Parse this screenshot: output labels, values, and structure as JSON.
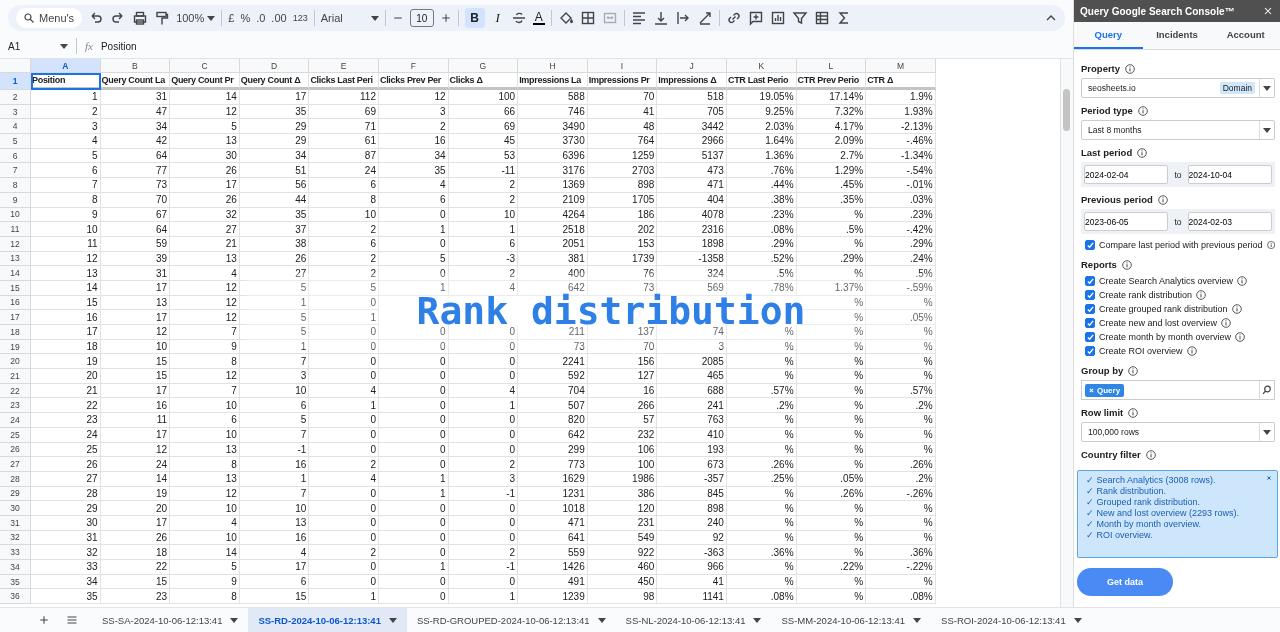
{
  "toolbar": {
    "search": "Menu's",
    "zoom": "100%",
    "currency": "£",
    "percent": "%",
    "decrease_decimals": ".0",
    "increase_decimals": ".00",
    "number_format": "123",
    "font": "Arial",
    "font_size": "10",
    "bold": {
      "label": "B",
      "selected": true
    },
    "italic": "I",
    "text_color": "A"
  },
  "formula_bar": {
    "cell_ref": "A1",
    "fx": "fx",
    "value": "Position"
  },
  "columns": [
    {
      "letter": "A",
      "selected": true
    },
    {
      "letter": "B",
      "selected": false
    },
    {
      "letter": "C",
      "selected": false
    },
    {
      "letter": "D",
      "selected": false
    },
    {
      "letter": "E",
      "selected": false
    },
    {
      "letter": "F",
      "selected": false
    },
    {
      "letter": "G",
      "selected": false
    },
    {
      "letter": "H",
      "selected": false
    },
    {
      "letter": "I",
      "selected": false
    },
    {
      "letter": "J",
      "selected": false
    },
    {
      "letter": "K",
      "selected": false
    },
    {
      "letter": "L",
      "selected": false
    },
    {
      "letter": "M",
      "selected": false
    }
  ],
  "header_row": {
    "num": "1",
    "selected": true,
    "cells": [
      "Position",
      "Query Count La",
      "Query Count Pr",
      "Query Count Δ",
      "Clicks Last Peri",
      "Clicks Prev Per",
      "Clicks Δ",
      "Impressions La",
      "Impressions Pr",
      "Impressions Δ",
      "CTR Last Perio",
      "CTR Prev Perio",
      "CTR Δ"
    ]
  },
  "rows": [
    {
      "num": "2",
      "cells": [
        "1",
        "31",
        "14",
        "17",
        "112",
        "12",
        "100",
        "588",
        "70",
        "518",
        "19.05%",
        "17.14%",
        "1.9%"
      ]
    },
    {
      "num": "3",
      "cells": [
        "2",
        "47",
        "12",
        "35",
        "69",
        "3",
        "66",
        "746",
        "41",
        "705",
        "9.25%",
        "7.32%",
        "1.93%"
      ]
    },
    {
      "num": "4",
      "cells": [
        "3",
        "34",
        "5",
        "29",
        "71",
        "2",
        "69",
        "3490",
        "48",
        "3442",
        "2.03%",
        "4.17%",
        "-2.13%"
      ]
    },
    {
      "num": "5",
      "cells": [
        "4",
        "42",
        "13",
        "29",
        "61",
        "16",
        "45",
        "3730",
        "764",
        "2966",
        "1.64%",
        "2.09%",
        "-.46%"
      ]
    },
    {
      "num": "6",
      "cells": [
        "5",
        "64",
        "30",
        "34",
        "87",
        "34",
        "53",
        "6396",
        "1259",
        "5137",
        "1.36%",
        "2.7%",
        "-1.34%"
      ]
    },
    {
      "num": "7",
      "cells": [
        "6",
        "77",
        "26",
        "51",
        "24",
        "35",
        "-11",
        "3176",
        "2703",
        "473",
        ".76%",
        "1.29%",
        "-.54%"
      ]
    },
    {
      "num": "8",
      "cells": [
        "7",
        "73",
        "17",
        "56",
        "6",
        "4",
        "2",
        "1369",
        "898",
        "471",
        ".44%",
        ".45%",
        "-.01%"
      ]
    },
    {
      "num": "9",
      "cells": [
        "8",
        "70",
        "26",
        "44",
        "8",
        "6",
        "2",
        "2109",
        "1705",
        "404",
        ".38%",
        ".35%",
        ".03%"
      ]
    },
    {
      "num": "10",
      "cells": [
        "9",
        "67",
        "32",
        "35",
        "10",
        "0",
        "10",
        "4264",
        "186",
        "4078",
        ".23%",
        "%",
        ".23%"
      ]
    },
    {
      "num": "11",
      "cells": [
        "10",
        "64",
        "27",
        "37",
        "2",
        "1",
        "1",
        "2518",
        "202",
        "2316",
        ".08%",
        ".5%",
        "-.42%"
      ]
    },
    {
      "num": "12",
      "cells": [
        "11",
        "59",
        "21",
        "38",
        "6",
        "0",
        "6",
        "2051",
        "153",
        "1898",
        ".29%",
        "%",
        ".29%"
      ]
    },
    {
      "num": "13",
      "cells": [
        "12",
        "39",
        "13",
        "26",
        "2",
        "5",
        "-3",
        "381",
        "1739",
        "-1358",
        ".52%",
        ".29%",
        ".24%"
      ]
    },
    {
      "num": "14",
      "cells": [
        "13",
        "31",
        "4",
        "27",
        "2",
        "0",
        "2",
        "400",
        "76",
        "324",
        ".5%",
        "%",
        ".5%"
      ]
    },
    {
      "num": "15",
      "cells": [
        "14",
        "17",
        "12",
        "5",
        "5",
        "1",
        "4",
        "642",
        "73",
        "569",
        ".78%",
        "1.37%",
        "-.59%"
      ]
    },
    {
      "num": "16",
      "cells": [
        "15",
        "13",
        "12",
        "1",
        "0",
        null,
        null,
        null,
        null,
        null,
        null,
        "%",
        "%"
      ]
    },
    {
      "num": "17",
      "cells": [
        "16",
        "17",
        "12",
        "5",
        "1",
        null,
        null,
        null,
        null,
        null,
        null,
        "%",
        ".05%"
      ]
    },
    {
      "num": "18",
      "cells": [
        "17",
        "12",
        "7",
        "5",
        "0",
        "0",
        "0",
        "211",
        "137",
        "74",
        "%",
        "%",
        "%"
      ]
    },
    {
      "num": "19",
      "cells": [
        "18",
        "10",
        "9",
        "1",
        "0",
        "0",
        "0",
        "73",
        "70",
        "3",
        "%",
        "%",
        "%"
      ]
    },
    {
      "num": "20",
      "cells": [
        "19",
        "15",
        "8",
        "7",
        "0",
        "0",
        "0",
        "2241",
        "156",
        "2085",
        "%",
        "%",
        "%"
      ]
    },
    {
      "num": "21",
      "cells": [
        "20",
        "15",
        "12",
        "3",
        "0",
        "0",
        "0",
        "592",
        "127",
        "465",
        "%",
        "%",
        "%"
      ]
    },
    {
      "num": "22",
      "cells": [
        "21",
        "17",
        "7",
        "10",
        "4",
        "0",
        "4",
        "704",
        "16",
        "688",
        ".57%",
        "%",
        ".57%"
      ]
    },
    {
      "num": "23",
      "cells": [
        "22",
        "16",
        "10",
        "6",
        "1",
        "0",
        "1",
        "507",
        "266",
        "241",
        ".2%",
        "%",
        ".2%"
      ]
    },
    {
      "num": "24",
      "cells": [
        "23",
        "11",
        "6",
        "5",
        "0",
        "0",
        "0",
        "820",
        "57",
        "763",
        "%",
        "%",
        "%"
      ]
    },
    {
      "num": "25",
      "cells": [
        "24",
        "17",
        "10",
        "7",
        "0",
        "0",
        "0",
        "642",
        "232",
        "410",
        "%",
        "%",
        "%"
      ]
    },
    {
      "num": "26",
      "cells": [
        "25",
        "12",
        "13",
        "-1",
        "0",
        "0",
        "0",
        "299",
        "106",
        "193",
        "%",
        "%",
        "%"
      ]
    },
    {
      "num": "27",
      "cells": [
        "26",
        "24",
        "8",
        "16",
        "2",
        "0",
        "2",
        "773",
        "100",
        "673",
        ".26%",
        "%",
        ".26%"
      ]
    },
    {
      "num": "28",
      "cells": [
        "27",
        "14",
        "13",
        "1",
        "4",
        "1",
        "3",
        "1629",
        "1986",
        "-357",
        ".25%",
        ".05%",
        ".2%"
      ]
    },
    {
      "num": "29",
      "cells": [
        "28",
        "19",
        "12",
        "7",
        "0",
        "1",
        "-1",
        "1231",
        "386",
        "845",
        "%",
        ".26%",
        "-.26%"
      ]
    },
    {
      "num": "30",
      "cells": [
        "29",
        "20",
        "10",
        "10",
        "0",
        "0",
        "0",
        "1018",
        "120",
        "898",
        "%",
        "%",
        "%"
      ]
    },
    {
      "num": "31",
      "cells": [
        "30",
        "17",
        "4",
        "13",
        "0",
        "0",
        "0",
        "471",
        "231",
        "240",
        "%",
        "%",
        "%"
      ]
    },
    {
      "num": "32",
      "cells": [
        "31",
        "26",
        "10",
        "16",
        "0",
        "0",
        "0",
        "641",
        "549",
        "92",
        "%",
        "%",
        "%"
      ]
    },
    {
      "num": "33",
      "cells": [
        "32",
        "18",
        "14",
        "4",
        "2",
        "0",
        "2",
        "559",
        "922",
        "-363",
        ".36%",
        "%",
        ".36%"
      ]
    },
    {
      "num": "34",
      "cells": [
        "33",
        "22",
        "5",
        "17",
        "0",
        "1",
        "-1",
        "1426",
        "460",
        "966",
        "%",
        ".22%",
        "-.22%"
      ]
    },
    {
      "num": "35",
      "cells": [
        "34",
        "15",
        "9",
        "6",
        "0",
        "0",
        "0",
        "491",
        "450",
        "41",
        "%",
        "%",
        "%"
      ]
    },
    {
      "num": "36",
      "cells": [
        "35",
        "23",
        "8",
        "15",
        "1",
        "0",
        "1",
        "1239",
        "98",
        "1141",
        ".08%",
        "%",
        ".08%"
      ]
    }
  ],
  "overlay_caption": "Rank distribution",
  "sidebar": {
    "title": "Query Google Search Console™",
    "tabs": [
      {
        "label": "Query",
        "selected": true
      },
      {
        "label": "Incidents",
        "selected": false
      },
      {
        "label": "Account",
        "selected": false
      }
    ],
    "property": {
      "label": "Property",
      "value": "seosheets.io",
      "badge": "Domain"
    },
    "period_type": {
      "label": "Period type",
      "value": "Last 8 months"
    },
    "last_period": {
      "label": "Last period",
      "from": "2024-02-04",
      "to_label": "to",
      "to": "2024-10-04"
    },
    "previous_period": {
      "label": "Previous period",
      "from": "2023-06-05",
      "to_label": "to",
      "to": "2024-02-03"
    },
    "compare": {
      "label": "Compare last period with previous period",
      "checked": true
    },
    "reports": {
      "label": "Reports",
      "items": [
        {
          "label": "Create Search Analytics overview",
          "checked": true
        },
        {
          "label": "Create rank distribution",
          "checked": true
        },
        {
          "label": "Create grouped rank distribution",
          "checked": true
        },
        {
          "label": "Create new and lost overview",
          "checked": true
        },
        {
          "label": "Create month by month overview",
          "checked": true
        },
        {
          "label": "Create ROI overview",
          "checked": true
        }
      ]
    },
    "group_by": {
      "label": "Group by",
      "chips": [
        "Query"
      ]
    },
    "row_limit": {
      "label": "Row limit",
      "value": "100,000 rows"
    },
    "country_filter": {
      "label": "Country filter"
    },
    "toast": {
      "lines": [
        "✓ Search Analytics (3008 rows).",
        "✓ Rank distribution.",
        "✓ Grouped rank distribution.",
        "✓ New and lost overview (2293 rows).",
        "✓ Month by month overview.",
        "✓ ROI overview."
      ]
    },
    "get_data": "Get data"
  },
  "sheet_tabs": [
    {
      "label": "SS-SA-2024-10-06-12:13:41",
      "selected": false
    },
    {
      "label": "SS-RD-2024-10-06-12:13:41",
      "selected": true
    },
    {
      "label": "SS-RD-GROUPED-2024-10-06-12:13:41",
      "selected": false
    },
    {
      "label": "SS-NL-2024-10-06-12:13:41",
      "selected": false
    },
    {
      "label": "SS-MM-2024-10-06-12:13:41",
      "selected": false
    },
    {
      "label": "SS-ROI-2024-10-06-12:13:41",
      "selected": false
    }
  ]
}
